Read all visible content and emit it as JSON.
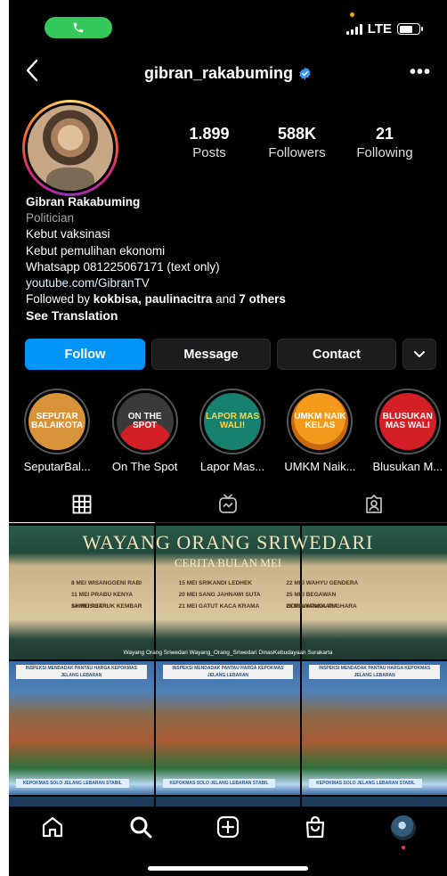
{
  "status_bar": {
    "network": "LTE"
  },
  "header": {
    "username": "gibran_rakabuming",
    "more": "•••"
  },
  "stats": [
    {
      "value": "1.899",
      "label": "Posts"
    },
    {
      "value": "588K",
      "label": "Followers"
    },
    {
      "value": "21",
      "label": "Following"
    }
  ],
  "bio": {
    "name": "Gibran Rakabuming",
    "category": "Politician",
    "lines": [
      "Kebut vaksinasi",
      "Kebut pemulihan ekonomi",
      "Whatsapp 081225067171 (text only)"
    ],
    "link": "youtube.com/GibranTV",
    "followed_prefix": "Followed by ",
    "followed_names": "kokbisa, paulinacitra",
    "followed_and": " and ",
    "followed_others": "7 others",
    "translate": "See Translation"
  },
  "actions": {
    "follow": "Follow",
    "message": "Message",
    "contact": "Contact"
  },
  "highlights": [
    {
      "label": "SeputarBal...",
      "cover_text": "SEPUTAR BALAIKOTA",
      "bg": "#d8923a",
      "fg": "#ffffff"
    },
    {
      "label": "On The Spot",
      "cover_text": "ON THE SPOT",
      "bg": "#3a3a3a",
      "fg": "#ffffff"
    },
    {
      "label": "Lapor Mas...",
      "cover_text": "LAPOR MAS WALI!",
      "bg": "#17806e",
      "fg": "#ffd23f"
    },
    {
      "label": "UMKM Naik...",
      "cover_text": "UMKM NAIK KELAS",
      "bg": "#f39a1d",
      "fg": "#ffffff"
    },
    {
      "label": "Blusukan M...",
      "cover_text": "BLUSUKAN MAS WALI",
      "bg": "#d32027",
      "fg": "#ffffff"
    }
  ],
  "banner": {
    "title": "WAYANG ORANG SRIWEDARI",
    "subtitle": "CERITA BULAN MEI",
    "rows": [
      "8 MEI  WISANGGENI RABI",
      "15 MEI  SRIKANDI LEDHEK",
      "22 MEI  WAHYU GENDERA",
      "11 MEI  PRABU KENYA SHIRUSLIARI",
      "20 MEI  SANG JAHNAWI SUTA",
      "25 MEI  BEGAWAN GORAWANGKARA",
      "14 MEI  PETRUK KEMBAR",
      "21 MEI  GATUT KACA KRAMA",
      "28 MEI  APAKA ANGHARA"
    ],
    "footer": "Wayang Orang Sriwedari   Wayang_Orang_Sriwedari   DinasKebudayaan Surakarta"
  },
  "market_posts": [
    {
      "caption": "INSPEKSI MENDADAK PANTAU HARGA KEPOKMAS JELANG LEBARAN",
      "footer": "KEPOKMAS SOLO JELANG LEBARAN STABIL"
    },
    {
      "caption": "INSPEKSI MENDADAK PANTAU HARGA KEPOKMAS JELANG LEBARAN",
      "footer": "KEPOKMAS SOLO JELANG LEBARAN STABIL"
    },
    {
      "caption": "INSPEKSI MENDADAK PANTAU HARGA KEPOKMAS JELANG LEBARAN",
      "footer": "KEPOKMAS SOLO JELANG LEBARAN STABIL"
    }
  ],
  "colors": {
    "follow": "#0095f6",
    "verified": "#3897f0",
    "call": "#34c759"
  }
}
